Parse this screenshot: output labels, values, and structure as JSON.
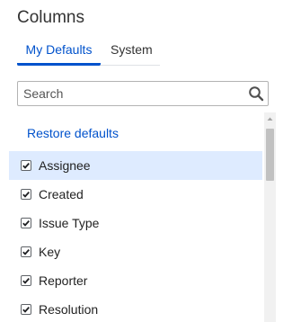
{
  "panel": {
    "title": "Columns"
  },
  "tabs": [
    {
      "label": "My Defaults",
      "active": true
    },
    {
      "label": "System",
      "active": false
    }
  ],
  "search": {
    "placeholder": "Search",
    "value": ""
  },
  "restore_label": "Restore defaults",
  "columns": [
    {
      "label": "Assignee",
      "checked": true,
      "selected": true
    },
    {
      "label": "Created",
      "checked": true,
      "selected": false
    },
    {
      "label": "Issue Type",
      "checked": true,
      "selected": false
    },
    {
      "label": "Key",
      "checked": true,
      "selected": false
    },
    {
      "label": "Reporter",
      "checked": true,
      "selected": false
    },
    {
      "label": "Resolution",
      "checked": true,
      "selected": false
    }
  ],
  "icons": {
    "search": "search-icon",
    "checkbox": "checkmark-icon",
    "scroll_up": "chevron-up-icon"
  },
  "colors": {
    "accent": "#0052cc",
    "selected_row": "#deebff"
  }
}
